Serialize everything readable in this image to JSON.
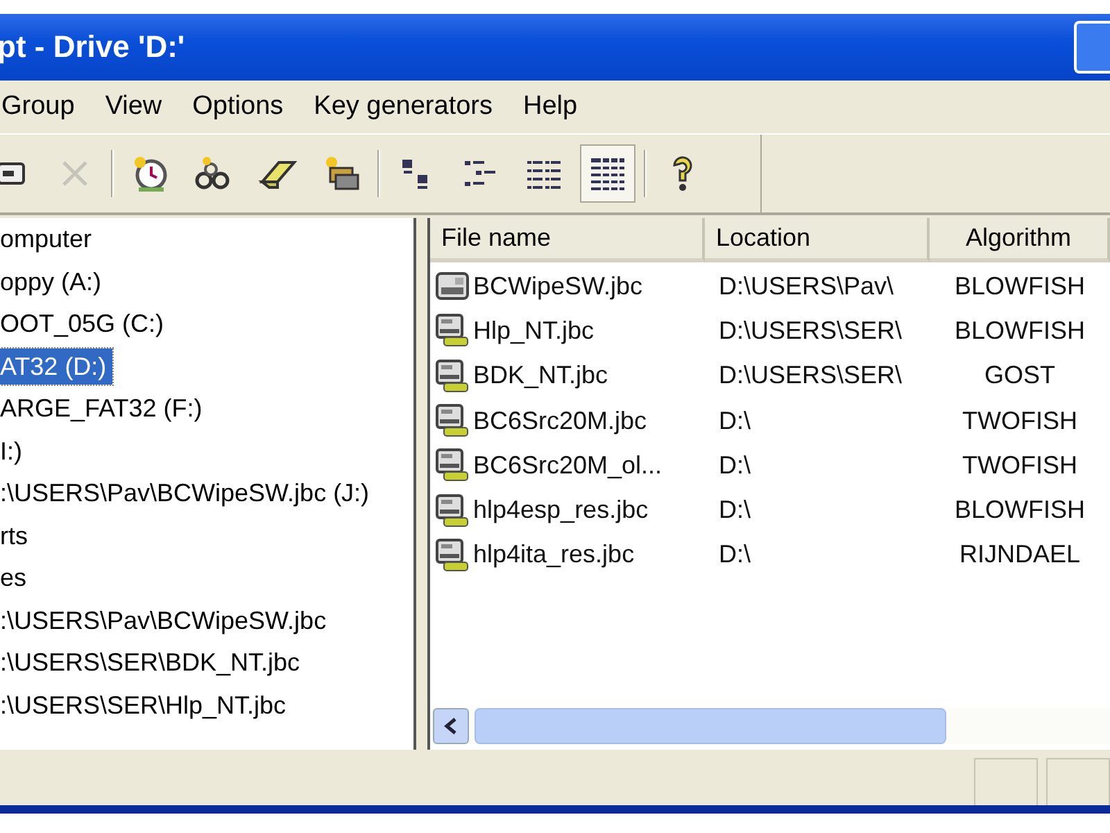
{
  "window": {
    "title": "pt - Drive 'D:'"
  },
  "menu": [
    "Group",
    "View",
    "Options",
    "Key generators",
    "Help"
  ],
  "toolbar": [
    {
      "kind": "properties",
      "pressed": false,
      "disabled": false
    },
    {
      "kind": "delete",
      "pressed": false,
      "disabled": true
    },
    {
      "kind": "sep"
    },
    {
      "kind": "clock",
      "pressed": false,
      "disabled": false
    },
    {
      "kind": "keys",
      "pressed": false,
      "disabled": false
    },
    {
      "kind": "eraser",
      "pressed": false,
      "disabled": false
    },
    {
      "kind": "folder",
      "pressed": false,
      "disabled": false
    },
    {
      "kind": "sep"
    },
    {
      "kind": "large",
      "pressed": false,
      "disabled": false
    },
    {
      "kind": "small",
      "pressed": false,
      "disabled": false
    },
    {
      "kind": "list",
      "pressed": false,
      "disabled": false
    },
    {
      "kind": "details",
      "pressed": true,
      "disabled": false
    },
    {
      "kind": "sep"
    },
    {
      "kind": "help",
      "pressed": false,
      "disabled": false
    }
  ],
  "tree": [
    {
      "label": "omputer",
      "selected": false
    },
    {
      "label": "oppy (A:)",
      "selected": false
    },
    {
      "label": "OOT_05G (C:)",
      "selected": false
    },
    {
      "label": "AT32 (D:)",
      "selected": true
    },
    {
      "label": "ARGE_FAT32 (F:)",
      "selected": false
    },
    {
      "label": "I:)",
      "selected": false
    },
    {
      "label": ":\\USERS\\Pav\\BCWipeSW.jbc (J:)",
      "selected": false
    },
    {
      "label": "rts",
      "selected": false
    },
    {
      "label": "es",
      "selected": false
    },
    {
      "label": ":\\USERS\\Pav\\BCWipeSW.jbc",
      "selected": false
    },
    {
      "label": ":\\USERS\\SER\\BDK_NT.jbc",
      "selected": false
    },
    {
      "label": ":\\USERS\\SER\\Hlp_NT.jbc",
      "selected": false
    }
  ],
  "table": {
    "columns": [
      "File name",
      "Location",
      "Algorithm"
    ],
    "rows": [
      {
        "kind": "mounted",
        "cells": [
          "BCWipeSW.jbc",
          "D:\\USERS\\Pav\\",
          "BLOWFISH"
        ]
      },
      {
        "kind": "container",
        "cells": [
          "Hlp_NT.jbc",
          "D:\\USERS\\SER\\",
          "BLOWFISH"
        ]
      },
      {
        "kind": "container",
        "cells": [
          "BDK_NT.jbc",
          "D:\\USERS\\SER\\",
          "GOST"
        ]
      },
      {
        "kind": "container",
        "cells": [
          "BC6Src20M.jbc",
          "D:\\",
          "TWOFISH"
        ]
      },
      {
        "kind": "container",
        "cells": [
          "BC6Src20M_ol...",
          "D:\\",
          "TWOFISH"
        ]
      },
      {
        "kind": "container",
        "cells": [
          "hlp4esp_res.jbc",
          "D:\\",
          "BLOWFISH"
        ]
      },
      {
        "kind": "container",
        "cells": [
          "hlp4ita_res.jbc",
          "D:\\",
          "RIJNDAEL"
        ]
      }
    ]
  }
}
